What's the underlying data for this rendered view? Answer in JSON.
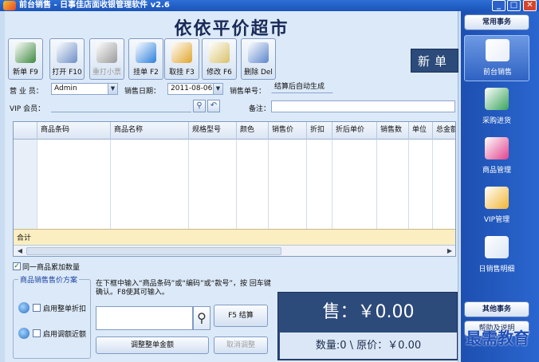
{
  "window": {
    "title": "前台销售 - 日事佳店面收银管理软件 v2.6",
    "controls": {
      "minimize": "_",
      "maximize": "□",
      "close": "✕"
    }
  },
  "store": {
    "name": "依依平价超市"
  },
  "toolbar": {
    "buttons": [
      {
        "label": "新单 F9",
        "icon": "new-order-icon",
        "color": "#3f8a3f"
      },
      {
        "label": "打开 F10",
        "icon": "folder-open-icon",
        "color": "#6d8fc6"
      },
      {
        "label": "重打小票",
        "icon": "printer-icon",
        "color": "#9a9a9a",
        "disabled": true
      },
      {
        "label": "挂单 F2",
        "icon": "tag-icon",
        "color": "#2c7fdc"
      },
      {
        "label": "取挂 F3",
        "icon": "lock-icon",
        "color": "#e0a52b"
      },
      {
        "label": "修改 F6",
        "icon": "edit-icon",
        "color": "#d9c26a"
      },
      {
        "label": "删除 Del",
        "icon": "delete-icon",
        "color": "#5b86cc"
      }
    ]
  },
  "order_status": "新单",
  "form": {
    "clerk_label": "营 业 员：",
    "clerk_value": "Admin",
    "date_label": "销售日期：",
    "date_value": "2011-08-06",
    "order_no_label": "销售单号：",
    "order_no_value": "结算后自动生成",
    "vip_label": "VIP 会员：",
    "vip_value": "",
    "remark_label": "备注：",
    "remark_value": ""
  },
  "grid": {
    "columns": [
      "",
      "商品条码",
      "商品名称",
      "规格型号",
      "颜色",
      "销售价",
      "折扣",
      "折后单价",
      "销售数",
      "单位",
      "总金额"
    ],
    "total_label": "合计"
  },
  "options": {
    "merge_same_qty": "同一商品累加数量",
    "merge_same_qty_checked": true
  },
  "pricing_scheme": {
    "title": "商品销售售价方案",
    "whole_discount": "启用整单折扣",
    "whole_discount_checked": false,
    "adjust_round": "启用调额近额",
    "adjust_round_checked": false
  },
  "entry": {
    "hint": "在下框中输入“商品条码”或“编码”或“款号”，按 回车键 确认。F8使其可输入。",
    "barcode_value": "",
    "checkout_button": "F5 结算",
    "adjust_button": "调整整单金额",
    "cancel_adjust_button": "取消调整"
  },
  "summary": {
    "sale_total": "售：￥0.00",
    "qty_original": "数量:0 \\ 原价：￥0.00"
  },
  "sidebar": {
    "header_common": "常用事务",
    "items": [
      {
        "label": "前台销售",
        "icon": "monitor-icon",
        "color": "#e8eef8",
        "active": true
      },
      {
        "label": "采购进货",
        "icon": "basket-icon",
        "color": "#37a35a",
        "active": false
      },
      {
        "label": "商品管理",
        "icon": "shirt-icon",
        "color": "#e0418c",
        "active": false
      },
      {
        "label": "VIP管理",
        "icon": "vip-users-icon",
        "color": "#f1b431",
        "active": false
      },
      {
        "label": "日销售明细",
        "icon": "report-search-icon",
        "color": "#d9e6f5",
        "active": false
      }
    ],
    "header_other": "其他事务",
    "other_items": [
      "帮助及说明"
    ]
  },
  "watermark": "最需教育"
}
